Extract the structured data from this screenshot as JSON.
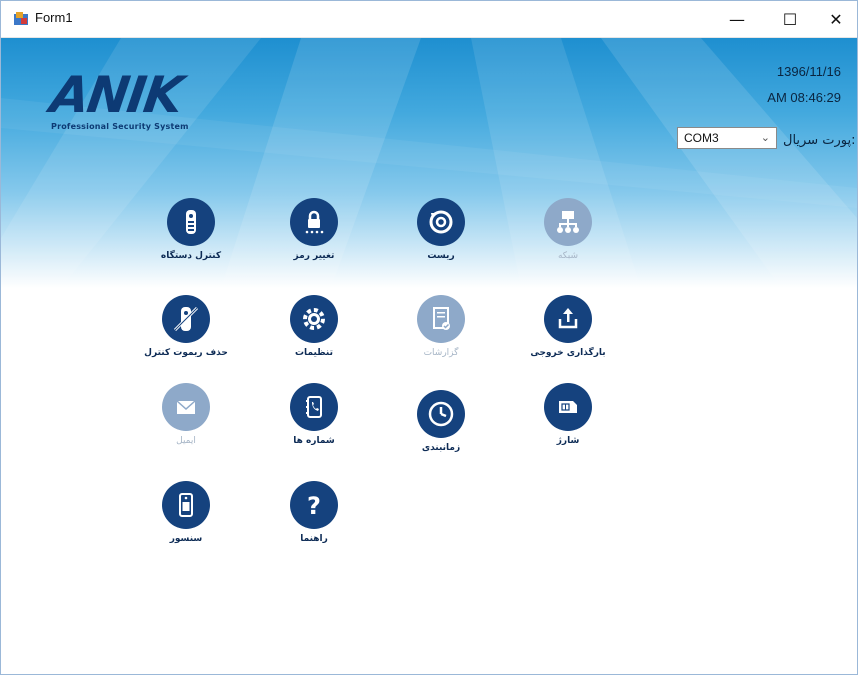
{
  "window": {
    "title": "Form1",
    "minimize_glyph": "—",
    "maximize_glyph": "☐",
    "close_glyph": "✕"
  },
  "brand": {
    "logo": "ANIK",
    "tagline": "Professional Security System"
  },
  "datetime": {
    "date": "1396/11/16",
    "time": "AM 08:46:29"
  },
  "serial": {
    "label": "پورت سریال:",
    "selected": "COM3"
  },
  "tiles": [
    {
      "label": "کنترل دستگاه",
      "icon": "remote-control-icon",
      "enabled": true
    },
    {
      "label": "تغییر رمز",
      "icon": "lock-keypad-icon",
      "enabled": true
    },
    {
      "label": "ریست",
      "icon": "reset-icon",
      "enabled": true
    },
    {
      "label": "شبکه",
      "icon": "network-icon",
      "enabled": false
    },
    {
      "label": "حذف ریموت کنترل",
      "icon": "remote-remove-icon",
      "enabled": true
    },
    {
      "label": "تنظیمات",
      "icon": "settings-gear-icon",
      "enabled": true
    },
    {
      "label": "گزارشات",
      "icon": "report-icon",
      "enabled": false
    },
    {
      "label": "بارگذاری خروجی",
      "icon": "upload-icon",
      "enabled": true
    },
    {
      "label": "ایمیل",
      "icon": "email-icon",
      "enabled": false
    },
    {
      "label": "شماره ها",
      "icon": "phonebook-icon",
      "enabled": true
    },
    {
      "label": "زمانبندی",
      "icon": "clock-icon",
      "enabled": true
    },
    {
      "label": "شارژ",
      "icon": "sim-card-icon",
      "enabled": true
    },
    {
      "label": "سنسور",
      "icon": "sensor-icon",
      "enabled": true
    },
    {
      "label": "راهنما",
      "icon": "help-icon",
      "enabled": true
    }
  ],
  "colors": {
    "icon_enabled": "#15427e",
    "icon_disabled": "#8ea9c9",
    "logo": "#0d3a74"
  }
}
